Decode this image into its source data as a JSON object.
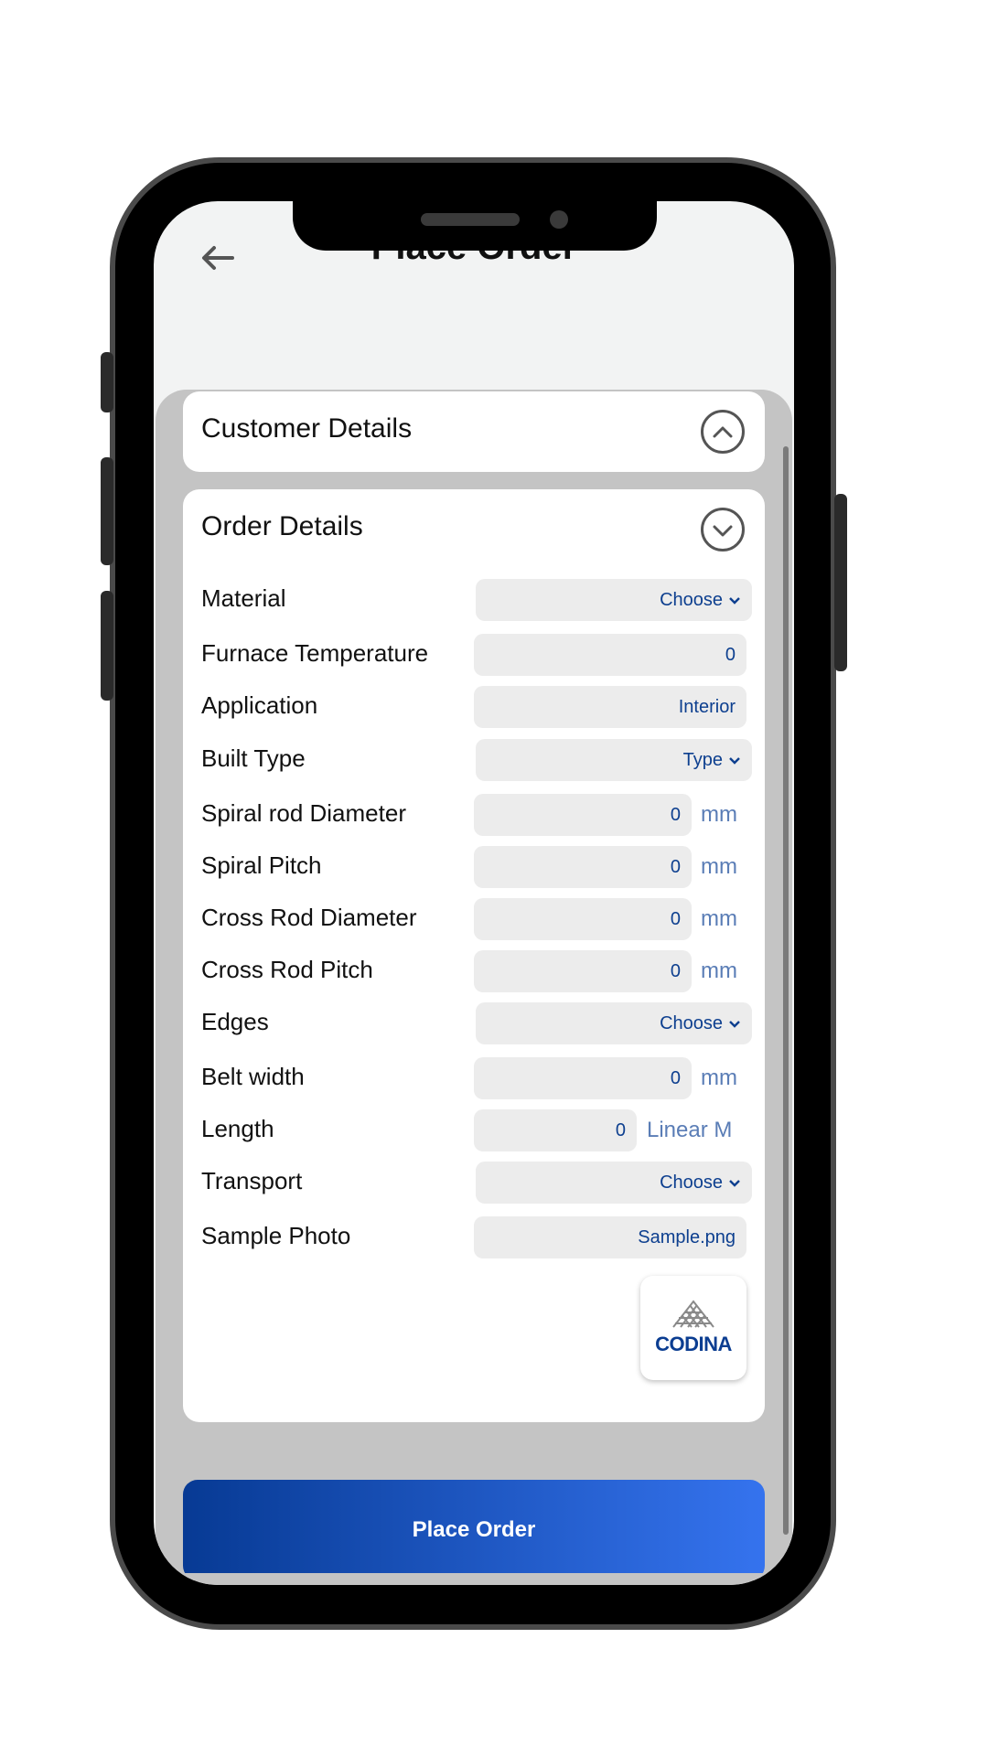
{
  "header": {
    "title": "Place Order"
  },
  "customer_details": {
    "title": "Customer Details"
  },
  "order_details": {
    "title": "Order Details",
    "rows": [
      {
        "label": "Material",
        "value": "Choose",
        "type": "dropdown"
      },
      {
        "label": "Furnace Temperature",
        "value": "0",
        "type": "input"
      },
      {
        "label": "Application",
        "value": "Interior",
        "type": "input"
      },
      {
        "label": "Built Type",
        "value": "Type",
        "type": "dropdown"
      },
      {
        "label": "Spiral rod Diameter",
        "value": "0",
        "unit": "mm",
        "type": "input"
      },
      {
        "label": "Spiral Pitch",
        "value": "0",
        "unit": "mm",
        "type": "input"
      },
      {
        "label": "Cross Rod Diameter",
        "value": "0",
        "unit": "mm",
        "type": "input"
      },
      {
        "label": "Cross Rod Pitch",
        "value": "0",
        "unit": "mm",
        "type": "input"
      },
      {
        "label": "Edges",
        "value": "Choose",
        "type": "dropdown"
      },
      {
        "label": "Belt width",
        "value": "0",
        "unit": "mm",
        "type": "input"
      },
      {
        "label": "Length",
        "value": "0",
        "unit": "Linear M",
        "type": "input"
      },
      {
        "label": "Transport",
        "value": "Choose",
        "type": "dropdown"
      },
      {
        "label": "Sample Photo",
        "value": "Sample.png",
        "type": "input"
      }
    ],
    "logo_text": "CODINA"
  },
  "actions": {
    "place_order": "Place Order"
  },
  "colors": {
    "accent_start": "#073a94",
    "accent_end": "#3573ee",
    "field_text": "#0d3f8f"
  }
}
